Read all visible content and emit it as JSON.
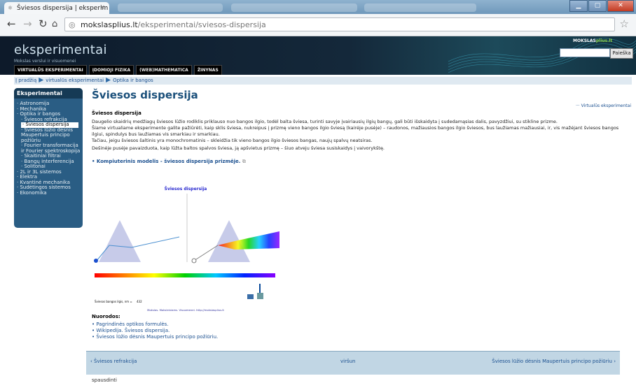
{
  "browser": {
    "tab_title": "Šviesos dispersija | eksperim",
    "url_host": "mokslasplius.lt",
    "url_path": "/eksperimentai/sviesos-dispersija"
  },
  "site": {
    "title": "eksperimentai",
    "subtitle": "Mokslas verslui ir visuomenei",
    "brand_prefix": "MOKSLAS",
    "brand_suffix": "plius.lt",
    "search_button": "Paieška",
    "nav": [
      "VIRTUALŪS EKSPERIMENTAI",
      "ĮDOMIOJI FIZIKA",
      "(WEB)MATHEMATICA",
      "ŽINYNAS"
    ]
  },
  "breadcrumb": [
    "Į pradžią",
    "virtualūs eksperimentai",
    "Optika ir bangos"
  ],
  "sidebar": {
    "heading": "Eksperimentai",
    "items": [
      {
        "label": "Astronomija",
        "level": 1
      },
      {
        "label": "Mechanika",
        "level": 1
      },
      {
        "label": "Optika ir bangos",
        "level": 1
      },
      {
        "label": "Šviesos refrakcija",
        "level": 2
      },
      {
        "label": "Šviesos dispersija",
        "level": 2,
        "current": true
      },
      {
        "label": "Šviesos lūžio dėsnis Maupertuis principo požiūriu",
        "level": 2
      },
      {
        "label": "Fourier transformacija ir Fourier spektroskopija",
        "level": 2
      },
      {
        "label": "Skaitiniai filtrai",
        "level": 2
      },
      {
        "label": "Bangų interferencija",
        "level": 2
      },
      {
        "label": "Solitonai",
        "level": 2
      },
      {
        "label": "2L ir 3L sistemos",
        "level": 1
      },
      {
        "label": "Elektra",
        "level": 1
      },
      {
        "label": "Kvantinė mechanika",
        "level": 1
      },
      {
        "label": "Sudėtingos sistemos",
        "level": 1
      },
      {
        "label": "Ekonomika",
        "level": 1
      }
    ]
  },
  "main": {
    "title": "Šviesos dispersija",
    "back_link": "··· Virtualūs eksperimentai",
    "section_heading": "Šviesos dispersija",
    "paragraphs": [
      "Daugelio skaidrių medžiagų šviesos lūžio rodiklis priklauso nuo bangos ilgio, todėl balta šviesa, turinti savyje įvairiausių ilgių bangų, gali būti išskaidyta į sudedamąsias dalis, pavyzdžiui, su stikline prizme.",
      "Šiame virtualiame eksperimente galite pažiūrėti, kaip sklis šviesa, nukreipus į prizmę vieno bangos ilgio šviesą (kairėje pusėje) – raudonos, mažiausios bangos ilgio šviesos, bus laužiamas mažiausiai, ir, vis mažėjant šviesos bangos ilgiui, spindulys bus laužiamas vis smarkiau ir smarkiau.",
      "Tačiau, jeigu šviesos šaltinis yra monochromatinis – skleidžia tik vieno bangos ilgio šviesos bangas, naujų spalvų neatsiras.",
      "Dešinėje pusėje pavaizduota, kaip lūžta baltos spalvos šviesa, ją apšvietus prizmę – šiuo atveju šviesa susiskaidys į vaivorykštę."
    ],
    "model_link": "Kompiuterinis modelis - šviesos dispersija prizmėje."
  },
  "applet": {
    "title": "Šviesos dispersija",
    "wavelength_label": "Šviesos bangos ilgis, nm =",
    "wavelength_value": "432",
    "footer": "Mokslas. Moksleiviams. Visuomenei.  http://mokslasplius.lt"
  },
  "links": {
    "heading": "Nuorodos:",
    "items": [
      "Pagrindinės optikos formulės.",
      "Wikipedija. Šviesos dispersija.",
      "Šviesos lūžio dėsnis Maupertuis principo požiūriu."
    ]
  },
  "bottom_nav": {
    "prev": "‹ Šviesos refrakcija",
    "up": "viršun",
    "next": "Šviesos lūžio dėsnis Maupertuis principo požiūriu ›"
  },
  "footer_text": "spausdinti"
}
